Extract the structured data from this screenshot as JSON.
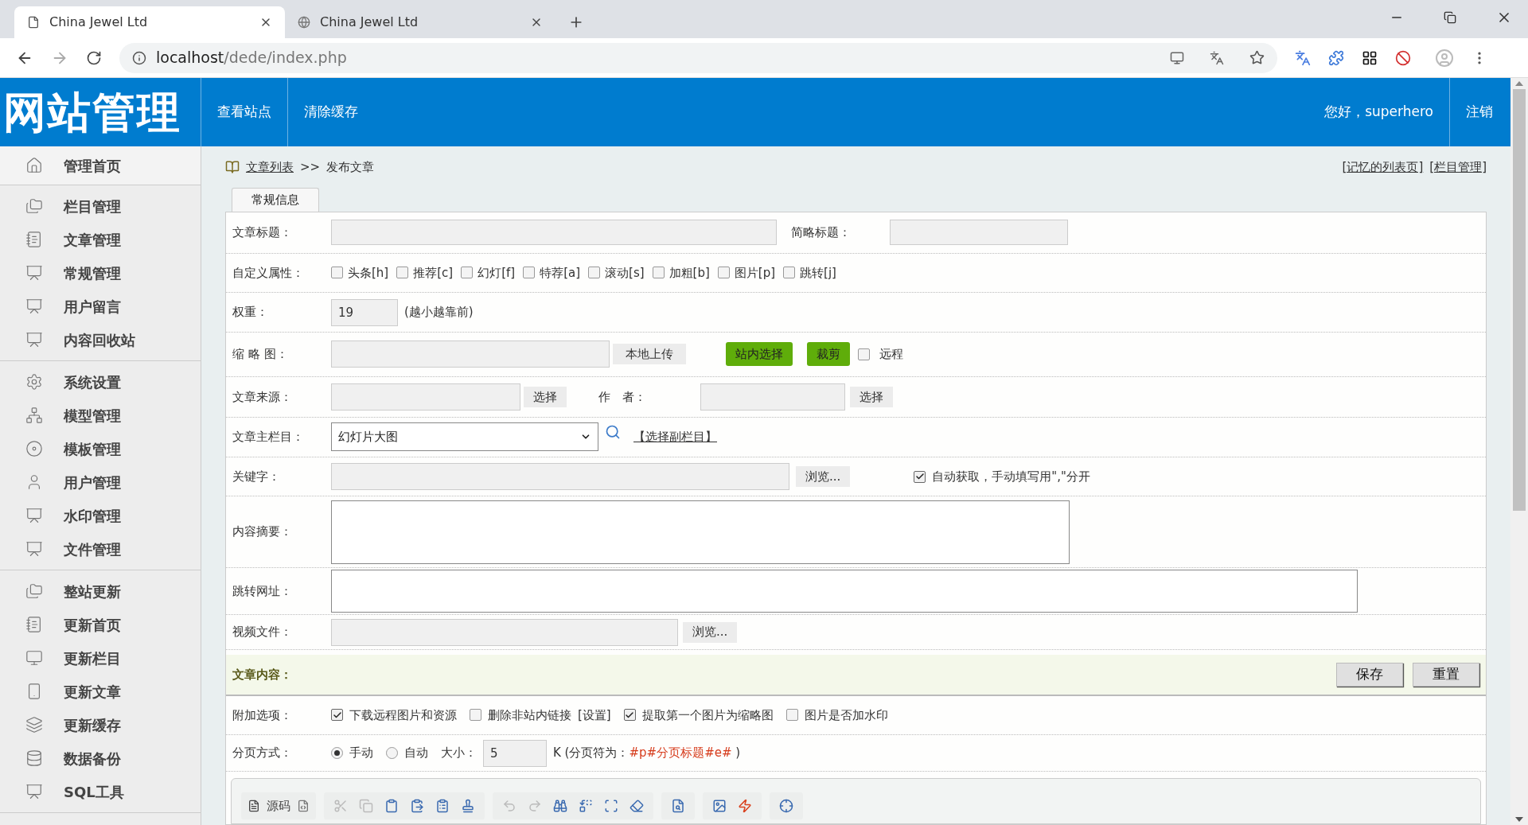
{
  "browser": {
    "tabs": [
      {
        "title": "China Jewel Ltd",
        "selected": true
      },
      {
        "title": "China Jewel Ltd",
        "selected": false
      }
    ],
    "url_host": "localhost",
    "url_path": "/dede/index.php"
  },
  "header": {
    "logo": "网站管理",
    "nav": [
      "查看站点",
      "清除缓存"
    ],
    "greeting": "您好，superhero",
    "logout": "注销"
  },
  "sidebar": {
    "groups": [
      [
        "管理首页"
      ],
      [
        "栏目管理",
        "文章管理",
        "常规管理",
        "用户留言",
        "内容回收站"
      ],
      [
        "系统设置",
        "模型管理",
        "模板管理",
        "用户管理",
        "水印管理",
        "文件管理"
      ],
      [
        "整站更新",
        "更新首页",
        "更新栏目",
        "更新文章",
        "更新缓存",
        "数据备份",
        "SQL工具"
      ]
    ]
  },
  "breadcrumb": {
    "link": "文章列表",
    "separator": ">>",
    "current": "发布文章",
    "right_links": [
      "[记忆的列表页]",
      "[栏目管理]"
    ]
  },
  "tabs": [
    {
      "label": "常规信息",
      "selected": true
    }
  ],
  "form": {
    "title": {
      "label": "文章标题：",
      "short_label": "简略标题："
    },
    "flags": {
      "label": "自定义属性：",
      "options": [
        {
          "label": "头条[h]",
          "checked": false
        },
        {
          "label": "推荐[c]",
          "checked": false
        },
        {
          "label": "幻灯[f]",
          "checked": false
        },
        {
          "label": "特荐[a]",
          "checked": false
        },
        {
          "label": "滚动[s]",
          "checked": false
        },
        {
          "label": "加粗[b]",
          "checked": false
        },
        {
          "label": "图片[p]",
          "checked": false
        },
        {
          "label": "跳转[j]",
          "checked": false
        }
      ]
    },
    "weight": {
      "label": "权重：",
      "value": "19",
      "hint": "(越小越靠前)"
    },
    "thumbnail": {
      "label": "缩 略 图：",
      "upload": "本地上传",
      "pick": "站内选择",
      "crop": "裁剪",
      "remote": {
        "label": "远程",
        "checked": false
      }
    },
    "source": {
      "label": "文章来源：",
      "button": "选择",
      "author_label": "作　者：",
      "author_button": "选择"
    },
    "column": {
      "label": "文章主栏目：",
      "value": "幻灯片大图",
      "link": "【选择副栏目】"
    },
    "keywords": {
      "label": "关键字：",
      "button": "浏览...",
      "auto": {
        "label": "自动获取，手动填写用\",\"分开",
        "checked": true
      }
    },
    "summary": {
      "label": "内容摘要："
    },
    "redirect": {
      "label": "跳转网址："
    },
    "video": {
      "label": "视频文件：",
      "button": "浏览..."
    },
    "content": {
      "label": "文章内容：",
      "buttons": [
        "保存",
        "重置"
      ]
    },
    "extras": {
      "label": "附加选项：",
      "options": [
        {
          "label": "下载远程图片和资源",
          "checked": true
        },
        {
          "label": "删除非站内链接",
          "checked": false,
          "settings_link": "[设置]"
        },
        {
          "label": "提取第一个图片为缩略图",
          "checked": true
        },
        {
          "label": "图片是否加水印",
          "checked": false
        }
      ]
    },
    "paging": {
      "label": "分页方式：",
      "modes": [
        {
          "label": "手动",
          "selected": true
        },
        {
          "label": "自动",
          "selected": false
        }
      ],
      "size_label": "大小：",
      "size": "5",
      "note": "K (分页符为：",
      "marker": "#p#分页标题#e#",
      "note_end": ")"
    },
    "editor": {
      "source_label": "源码"
    }
  }
}
